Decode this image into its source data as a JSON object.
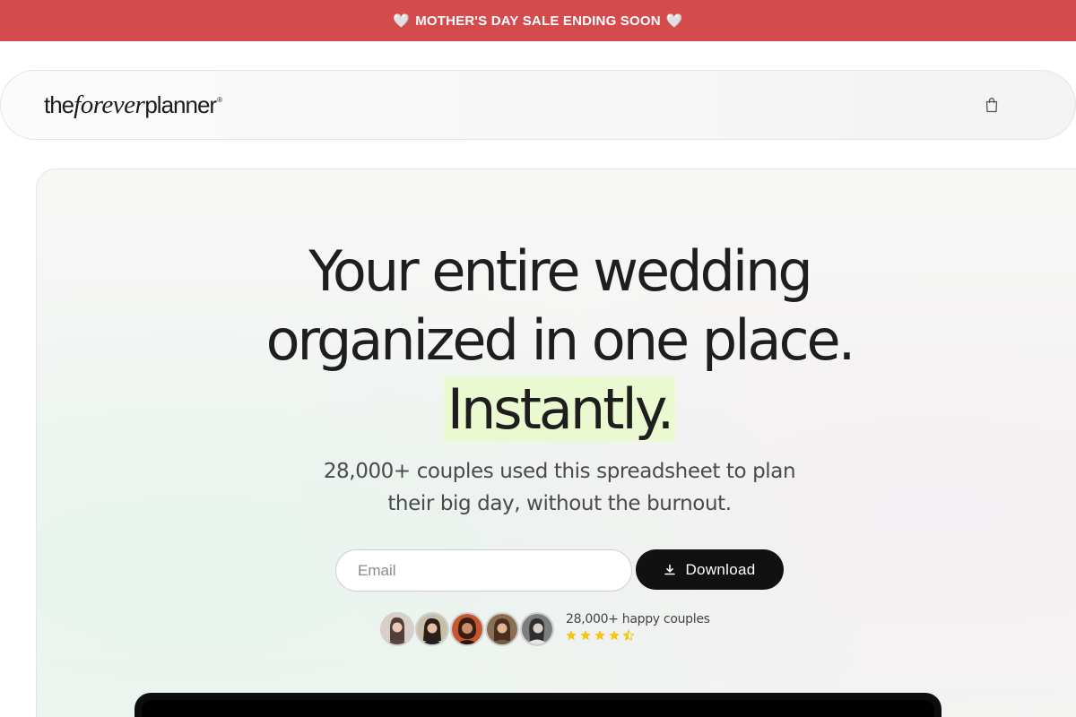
{
  "announcement": {
    "text": "MOTHER'S DAY SALE ENDING SOON",
    "heart": "🤍",
    "color": "#d34b4d"
  },
  "header": {
    "logo": {
      "part1": "the",
      "part2": "forever",
      "part3": "planner",
      "registered": "®"
    },
    "cart_icon": "shopping-bag-icon"
  },
  "hero": {
    "headline_line1": "Your entire wedding",
    "headline_line2": "organized in one place.",
    "headline_highlight": "Instantly.",
    "highlight_color": "#eaf9cf",
    "subheadline_line1": "28,000+ couples used this spreadsheet to plan",
    "subheadline_line2": "their big day, without the burnout.",
    "email_placeholder": "Email",
    "email_value": "",
    "download_label": "Download",
    "download_icon": "download-icon",
    "social_proof": {
      "text": "28,000+ happy couples",
      "rating": 4.5,
      "max_rating": 5,
      "star_color": "#f5c518",
      "avatar_count": 5
    }
  }
}
